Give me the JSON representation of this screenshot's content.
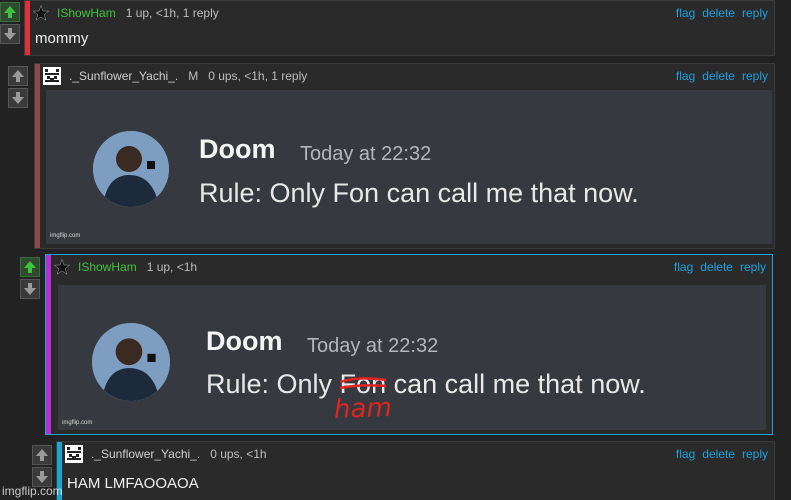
{
  "actions": {
    "flag": "flag",
    "delete": "delete",
    "reply": "reply"
  },
  "comments": [
    {
      "username": "IShowHam",
      "meta": "1 up, <1h, 1 reply",
      "text": "mommy"
    },
    {
      "username": "._Sunflower_Yachi_.",
      "badge": "M",
      "meta": "0 ups, <1h, 1 reply"
    },
    {
      "username": "IShowHam",
      "meta": "1 up, <1h"
    },
    {
      "username": "._Sunflower_Yachi_.",
      "meta": "0 ups, <1h",
      "text": "HAM LMFAOOAOA"
    }
  ],
  "discord1": {
    "name": "Doom",
    "time": "Today at 22:32",
    "message": "Rule: Only Fon can call me that now.",
    "watermark": "imgflip.com"
  },
  "discord2": {
    "name": "Doom",
    "time": "Today at 22:32",
    "message_before": "Rule: Only ",
    "struck": "Fon",
    "message_after": " can call me that now.",
    "handwritten": "ham",
    "watermark": "imgflip.com"
  },
  "site_watermark": "imgflip.com",
  "colors": {
    "accent_blue": "#1fa0dd",
    "green_user": "#3fc23f",
    "bar_red": "#e0303a",
    "bar_muted_red": "#8e4a4a",
    "bar_magenta": "#b62fd6",
    "bar_cyan": "#18a6d6"
  }
}
